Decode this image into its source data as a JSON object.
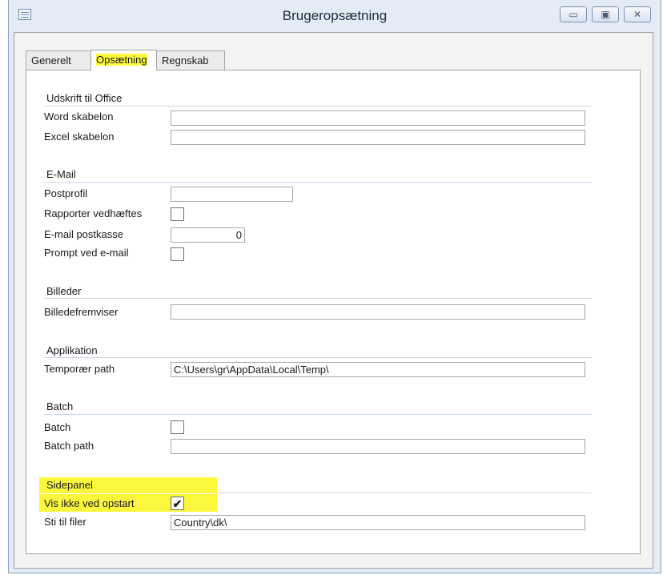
{
  "window": {
    "title": "Brugeropsætning"
  },
  "tabs": [
    {
      "label": "Generelt"
    },
    {
      "label": "Opsætning"
    },
    {
      "label": "Regnskab"
    }
  ],
  "sections": {
    "office": {
      "title": "Udskrift til Office",
      "word_label": "Word skabelon",
      "word_value": "",
      "excel_label": "Excel skabelon",
      "excel_value": ""
    },
    "email": {
      "title": "E-Mail",
      "postprofil_label": "Postprofil",
      "postprofil_value": "",
      "rapporter_label": "Rapporter vedhæftes",
      "rapporter_checked": false,
      "postkasse_label": "E-mail postkasse",
      "postkasse_value": "0",
      "prompt_label": "Prompt ved e-mail",
      "prompt_checked": false
    },
    "billeder": {
      "title": "Billeder",
      "fremviser_label": "Billedefremviser",
      "fremviser_value": ""
    },
    "applikation": {
      "title": "Applikation",
      "temp_label": "Temporær path",
      "temp_value": "C:\\Users\\gr\\AppData\\Local\\Temp\\"
    },
    "batch": {
      "title": "Batch",
      "batch_label": "Batch",
      "batch_checked": false,
      "path_label": "Batch path",
      "path_value": ""
    },
    "sidepanel": {
      "title": "Sidepanel",
      "vis_label": "Vis ikke ved opstart",
      "vis_checked": true,
      "check_glyph": "✔",
      "sti_label": "Sti til filer",
      "sti_value": "Country\\dk\\"
    }
  },
  "icons": {
    "app": "form-window-icon",
    "minimize": "minimize-icon",
    "maximize": "maximize-icon",
    "close": "close-icon"
  },
  "colors": {
    "highlight": "#fcf73c",
    "window_frame": "#e3ecf6"
  }
}
